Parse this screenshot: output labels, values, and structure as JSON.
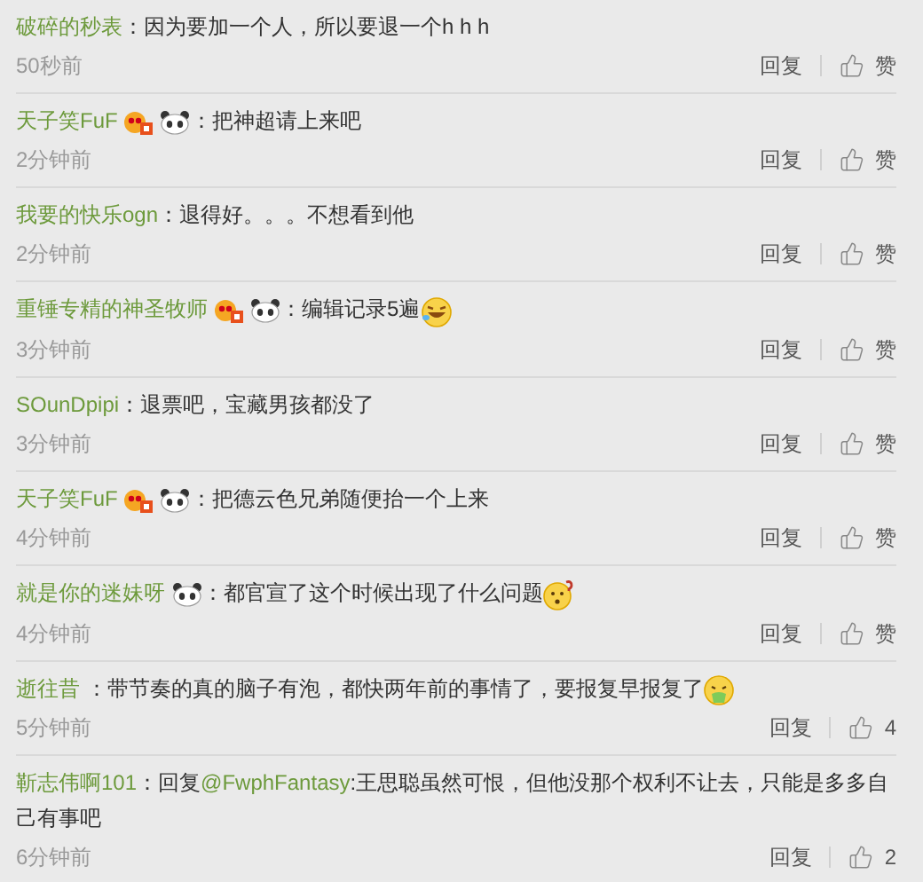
{
  "comments": [
    {
      "user": "破碎的秒表",
      "vip": false,
      "panda": false,
      "text": "：因为要加一个人，所以要退一个h h h",
      "time": "50秒前",
      "reply": "回复",
      "likes": "赞"
    },
    {
      "user": "天子笑FuF",
      "vip": true,
      "panda": true,
      "text": "：把神超请上来吧",
      "time": "2分钟前",
      "reply": "回复",
      "likes": "赞"
    },
    {
      "user": "我要的快乐ogn",
      "vip": false,
      "panda": false,
      "text": "：退得好。。。不想看到他",
      "time": "2分钟前",
      "reply": "回复",
      "likes": "赞"
    },
    {
      "user": "重锤专精的神圣牧师",
      "vip": true,
      "panda": true,
      "text": "：编辑记录5遍",
      "emoji": {
        "kind": "laugh"
      },
      "time": "3分钟前",
      "reply": "回复",
      "likes": "赞"
    },
    {
      "user": "SOunDpipi",
      "vip": false,
      "panda": false,
      "text": "：退票吧，宝藏男孩都没了",
      "time": "3分钟前",
      "reply": "回复",
      "likes": "赞"
    },
    {
      "user": "天子笑FuF",
      "vip": true,
      "panda": true,
      "text": "：把德云色兄弟随便抬一个上来",
      "time": "4分钟前",
      "reply": "回复",
      "likes": "赞"
    },
    {
      "user": "就是你的迷妹呀",
      "vip": false,
      "panda": true,
      "text": "：都官宣了这个时候出现了什么问题",
      "emoji": {
        "kind": "puzzled"
      },
      "time": "4分钟前",
      "reply": "回复",
      "likes": "赞"
    },
    {
      "user": "逝往昔",
      "vip": false,
      "panda": false,
      "text": " ：带节奏的真的脑子有泡，都快两年前的事情了，要报复早报复了",
      "emoji": {
        "kind": "sick"
      },
      "time": "5分钟前",
      "reply": "回复",
      "likes": "4"
    },
    {
      "user": "靳志伟啊101",
      "vip": false,
      "panda": false,
      "text": "：回复",
      "mention": "@FwphFantasy",
      "text_after": ":王思聪虽然可恨，但他没那个权利不让去，只能是多多自己有事吧",
      "time": "6分钟前",
      "reply": "回复",
      "likes": "2"
    }
  ]
}
